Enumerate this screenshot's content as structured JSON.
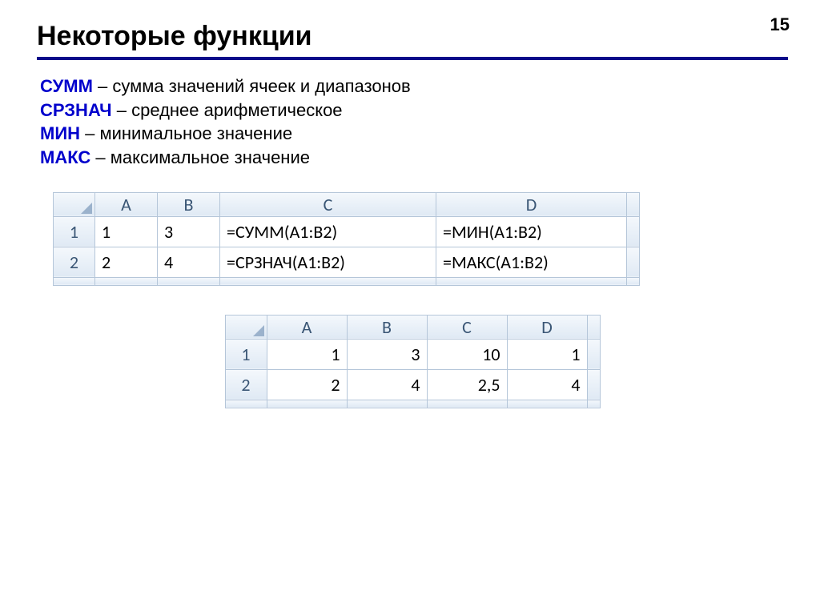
{
  "page_number": "15",
  "title": "Некоторые функции",
  "functions": [
    {
      "name": "СУММ",
      "desc": " – сумма значений ячеек и диапазонов"
    },
    {
      "name": "СРЗНАЧ",
      "desc": " – среднее арифметическое"
    },
    {
      "name": "МИН",
      "desc": " – минимальное значение"
    },
    {
      "name": "МАКС",
      "desc": " – максимальное значение"
    }
  ],
  "table1": {
    "cols": [
      "A",
      "B",
      "C",
      "D"
    ],
    "rows": [
      {
        "hdr": "1",
        "A": "1",
        "B": "3",
        "C": "=СУММ(A1:B2)",
        "D": "=МИН(A1:B2)"
      },
      {
        "hdr": "2",
        "A": "2",
        "B": "4",
        "C": "=СРЗНАЧ(A1:B2)",
        "D": "=МАКС(A1:B2)"
      }
    ]
  },
  "table2": {
    "cols": [
      "A",
      "B",
      "C",
      "D"
    ],
    "rows": [
      {
        "hdr": "1",
        "A": "1",
        "B": "3",
        "C": "10",
        "D": "1"
      },
      {
        "hdr": "2",
        "A": "2",
        "B": "4",
        "C": "2,5",
        "D": "4"
      }
    ]
  }
}
